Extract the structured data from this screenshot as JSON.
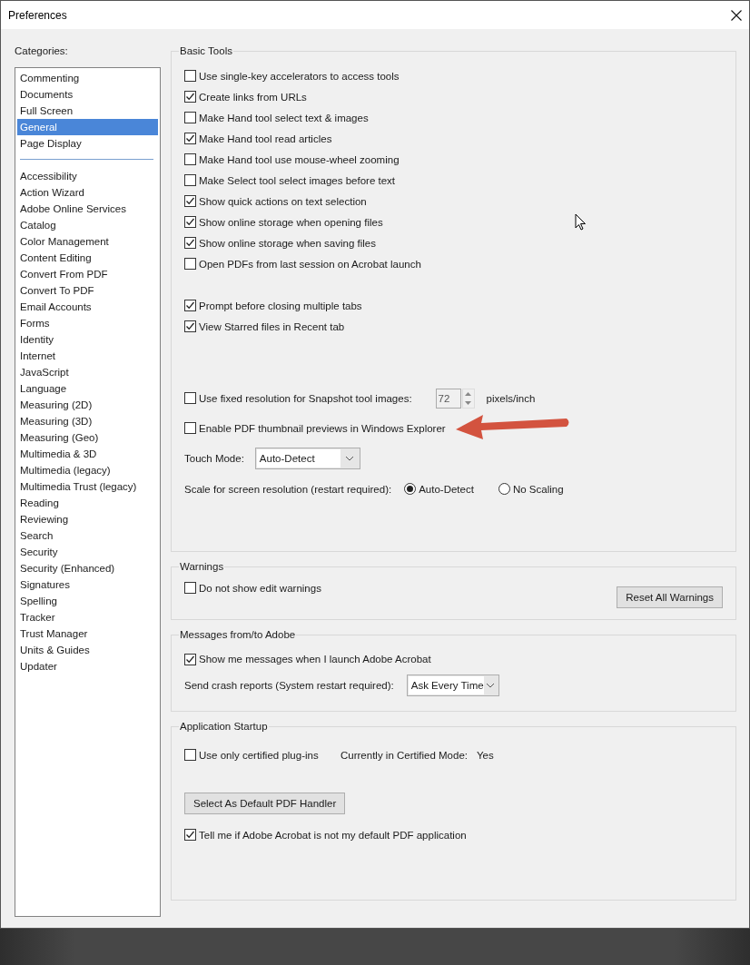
{
  "window": {
    "title": "Preferences"
  },
  "categories": {
    "label": "Categories:",
    "groups": [
      [
        {
          "label": "Commenting",
          "selected": false
        },
        {
          "label": "Documents",
          "selected": false
        },
        {
          "label": "Full Screen",
          "selected": false
        },
        {
          "label": "General",
          "selected": true
        },
        {
          "label": "Page Display",
          "selected": false
        }
      ],
      [
        {
          "label": "Accessibility",
          "selected": false
        },
        {
          "label": "Action Wizard",
          "selected": false
        },
        {
          "label": "Adobe Online Services",
          "selected": false
        },
        {
          "label": "Catalog",
          "selected": false
        },
        {
          "label": "Color Management",
          "selected": false
        },
        {
          "label": "Content Editing",
          "selected": false
        },
        {
          "label": "Convert From PDF",
          "selected": false
        },
        {
          "label": "Convert To PDF",
          "selected": false
        },
        {
          "label": "Email Accounts",
          "selected": false
        },
        {
          "label": "Forms",
          "selected": false
        },
        {
          "label": "Identity",
          "selected": false
        },
        {
          "label": "Internet",
          "selected": false
        },
        {
          "label": "JavaScript",
          "selected": false
        },
        {
          "label": "Language",
          "selected": false
        },
        {
          "label": "Measuring (2D)",
          "selected": false
        },
        {
          "label": "Measuring (3D)",
          "selected": false
        },
        {
          "label": "Measuring (Geo)",
          "selected": false
        },
        {
          "label": "Multimedia & 3D",
          "selected": false
        },
        {
          "label": "Multimedia (legacy)",
          "selected": false
        },
        {
          "label": "Multimedia Trust (legacy)",
          "selected": false
        },
        {
          "label": "Reading",
          "selected": false
        },
        {
          "label": "Reviewing",
          "selected": false
        },
        {
          "label": "Search",
          "selected": false
        },
        {
          "label": "Security",
          "selected": false
        },
        {
          "label": "Security (Enhanced)",
          "selected": false
        },
        {
          "label": "Signatures",
          "selected": false
        },
        {
          "label": "Spelling",
          "selected": false
        },
        {
          "label": "Tracker",
          "selected": false
        },
        {
          "label": "Trust Manager",
          "selected": false
        },
        {
          "label": "Units & Guides",
          "selected": false
        },
        {
          "label": "Updater",
          "selected": false
        }
      ]
    ]
  },
  "basic_tools": {
    "title": "Basic Tools",
    "option_groups": [
      [
        {
          "label": "Use single-key accelerators to access tools",
          "checked": false
        },
        {
          "label": "Create links from URLs",
          "checked": true
        },
        {
          "label": "Make Hand tool select text & images",
          "checked": false
        },
        {
          "label": "Make Hand tool read articles",
          "checked": true
        },
        {
          "label": "Make Hand tool use mouse-wheel zooming",
          "checked": false
        },
        {
          "label": "Make Select tool select images before text",
          "checked": false
        },
        {
          "label": "Show quick actions on text selection",
          "checked": true
        },
        {
          "label": "Show online storage when opening files",
          "checked": true
        },
        {
          "label": "Show online storage when saving files",
          "checked": true
        },
        {
          "label": "Open PDFs from last session on Acrobat launch",
          "checked": false
        }
      ],
      [
        {
          "label": "Prompt before closing multiple tabs",
          "checked": true
        },
        {
          "label": "View Starred files in Recent tab",
          "checked": true
        }
      ]
    ],
    "snapshot": {
      "label": "Use fixed resolution for Snapshot tool images:",
      "checked": false,
      "value": "72",
      "unit": "pixels/inch"
    },
    "thumbnail": {
      "label": "Enable PDF thumbnail previews in Windows Explorer",
      "checked": false
    },
    "touch_mode": {
      "label": "Touch Mode:",
      "value": "Auto-Detect"
    },
    "scale": {
      "label": "Scale for screen resolution (restart required):",
      "options": [
        {
          "label": "Auto-Detect",
          "selected": true
        },
        {
          "label": "No Scaling",
          "selected": false
        }
      ]
    }
  },
  "warnings": {
    "title": "Warnings",
    "option": {
      "label": "Do not show edit warnings",
      "checked": false
    },
    "button": "Reset All Warnings"
  },
  "messages": {
    "title": "Messages from/to Adobe",
    "option": {
      "label": "Show me messages when I launch Adobe Acrobat",
      "checked": true
    },
    "crash": {
      "label": "Send crash reports (System restart required):",
      "value": "Ask Every Time"
    }
  },
  "startup": {
    "title": "Application Startup",
    "option": {
      "label": "Use only certified plug-ins",
      "checked": false
    },
    "mode_label": "Currently in Certified Mode:",
    "mode_value": "Yes",
    "button": "Select As Default PDF Handler",
    "default_check": {
      "label": "Tell me if Adobe Acrobat is not my default PDF application",
      "checked": true
    }
  }
}
